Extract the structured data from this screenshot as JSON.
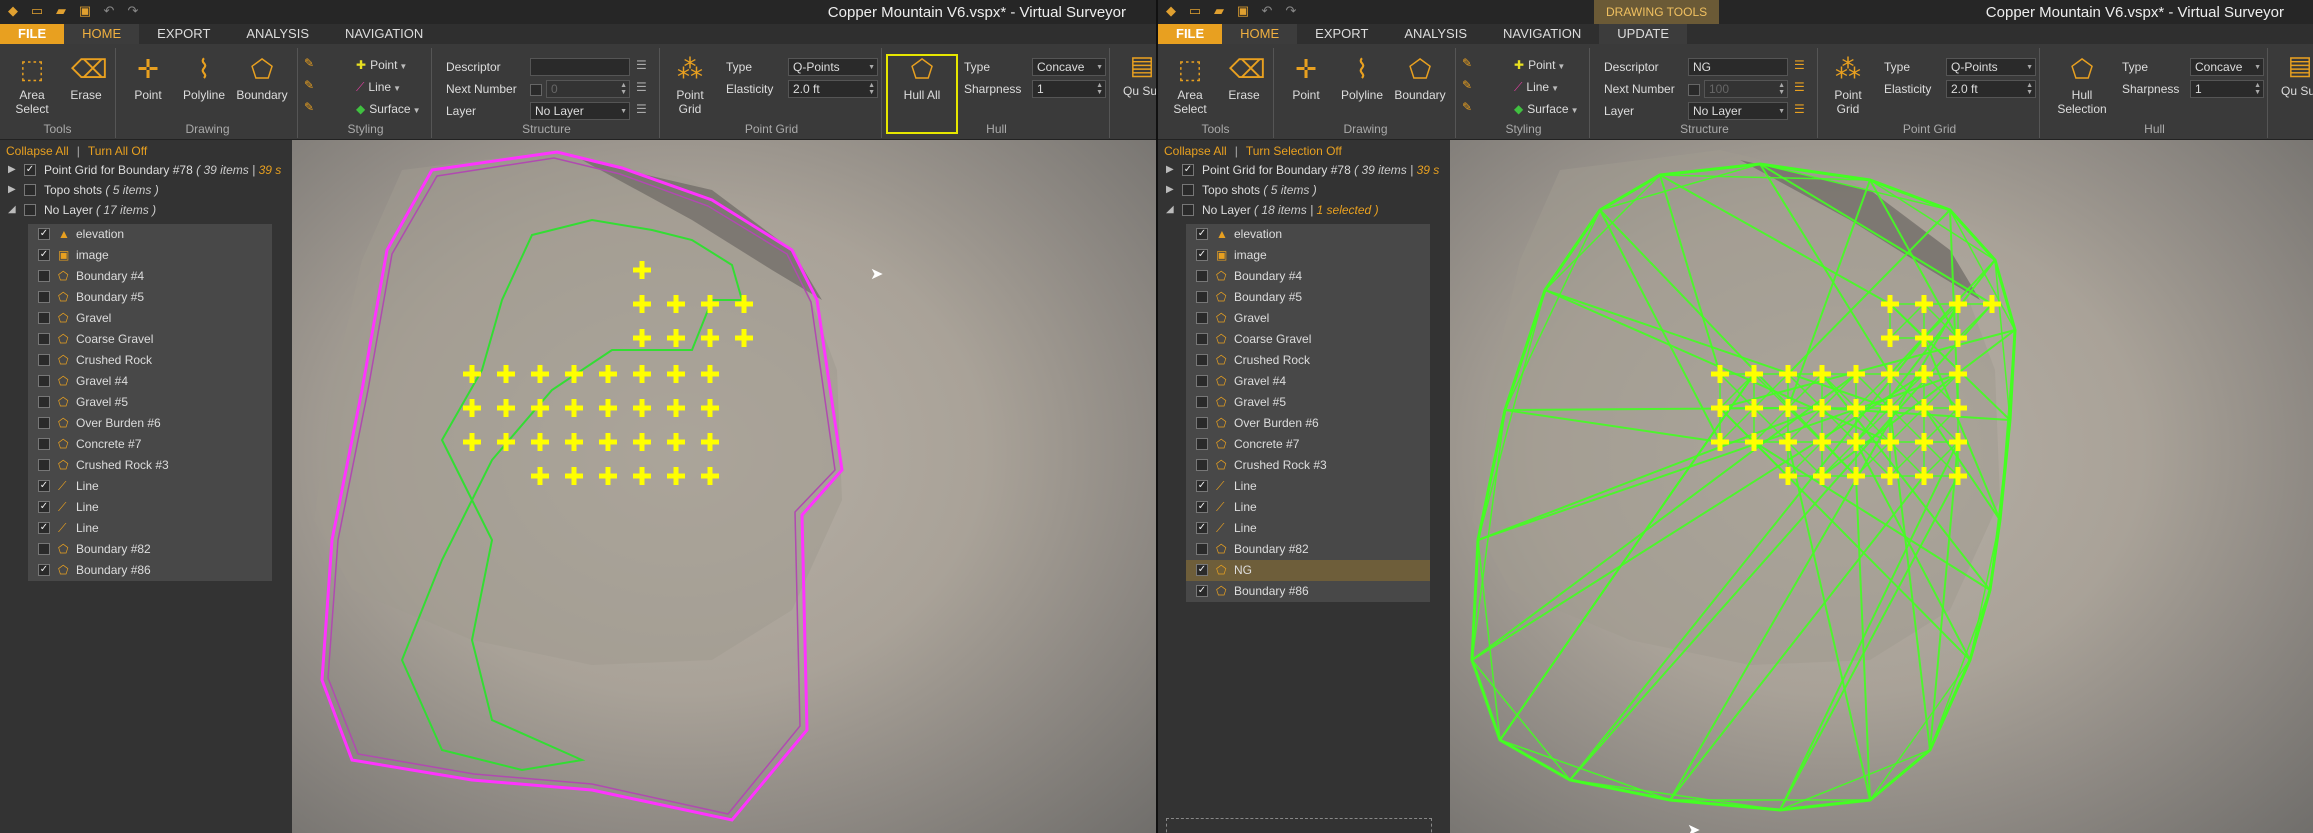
{
  "windows": {
    "left": {
      "title": "Copper Mountain V6.vspx*  -  Virtual Surveyor",
      "tabs": [
        "FILE",
        "HOME",
        "EXPORT",
        "ANALYSIS",
        "NAVIGATION"
      ],
      "active_tab": "HOME",
      "ribbon": {
        "tools": {
          "area_select": "Area Select",
          "erase": "Erase",
          "label": "Tools"
        },
        "drawing": {
          "point": "Point",
          "polyline": "Polyline",
          "boundary": "Boundary",
          "label": "Drawing"
        },
        "styling": {
          "point": "Point",
          "line": "Line",
          "surface": "Surface",
          "label": "Styling"
        },
        "structure": {
          "descriptor_label": "Descriptor",
          "descriptor_value": "",
          "next_number_label": "Next Number",
          "next_number_value": "0",
          "layer_label": "Layer",
          "layer_value": "No Layer",
          "label": "Structure"
        },
        "point_grid": {
          "button": "Point Grid",
          "type_label": "Type",
          "type_value": "Q-Points",
          "elasticity_label": "Elasticity",
          "elasticity_value": "2.0 ft",
          "label": "Point Grid"
        },
        "hull": {
          "button": "Hull All",
          "type_label": "Type",
          "type_value": "Concave",
          "sharpness_label": "Sharpness",
          "sharpness_value": "1",
          "label": "Hull"
        },
        "overflow": "Qu Sur"
      },
      "panel": {
        "collapse_all": "Collapse All",
        "turn_off": "Turn All Off",
        "top_items": [
          {
            "label": "Point Grid for Boundary #78",
            "count": "( 39 items |",
            "extra": "39 s",
            "checked": true
          },
          {
            "label": "Topo shots",
            "count": "( 5 items )",
            "checked": false
          },
          {
            "label": "No Layer",
            "count": "( 17 items )",
            "checked": false
          }
        ],
        "layers": [
          {
            "label": "elevation",
            "checked": true,
            "icon": "elevation-icon",
            "selected": false
          },
          {
            "label": "image",
            "checked": true,
            "icon": "image-icon",
            "selected": false
          },
          {
            "label": "Boundary #4",
            "checked": false,
            "icon": "boundary-icon",
            "selected": false
          },
          {
            "label": "Boundary #5",
            "checked": false,
            "icon": "boundary-icon",
            "selected": false
          },
          {
            "label": "Gravel",
            "checked": false,
            "icon": "boundary-icon",
            "selected": false
          },
          {
            "label": "Coarse Gravel",
            "checked": false,
            "icon": "boundary-icon",
            "selected": false
          },
          {
            "label": "Crushed Rock",
            "checked": false,
            "icon": "boundary-icon",
            "selected": false
          },
          {
            "label": "Gravel #4",
            "checked": false,
            "icon": "boundary-icon",
            "selected": false
          },
          {
            "label": "Gravel #5",
            "checked": false,
            "icon": "boundary-icon",
            "selected": false
          },
          {
            "label": "Over Burden #6",
            "checked": false,
            "icon": "boundary-icon",
            "selected": false
          },
          {
            "label": "Concrete #7",
            "checked": false,
            "icon": "boundary-icon",
            "selected": false
          },
          {
            "label": "Crushed Rock #3",
            "checked": false,
            "icon": "boundary-icon",
            "selected": false
          },
          {
            "label": "Line",
            "checked": true,
            "icon": "line-icon",
            "selected": false
          },
          {
            "label": "Line",
            "checked": true,
            "icon": "line-icon",
            "selected": false
          },
          {
            "label": "Line",
            "checked": true,
            "icon": "line-icon",
            "selected": false
          },
          {
            "label": "Boundary #82",
            "checked": false,
            "icon": "boundary-icon",
            "selected": false
          },
          {
            "label": "Boundary #86",
            "checked": true,
            "icon": "boundary-icon",
            "selected": false
          }
        ]
      }
    },
    "right": {
      "title": "Copper Mountain V6.vspx*  -  Virtual Surveyor",
      "context_tab_group": "DRAWING TOOLS",
      "tabs": [
        "FILE",
        "HOME",
        "EXPORT",
        "ANALYSIS",
        "NAVIGATION",
        "UPDATE"
      ],
      "active_tab": "HOME",
      "ribbon": {
        "tools": {
          "area_select": "Area Select",
          "erase": "Erase",
          "label": "Tools"
        },
        "drawing": {
          "point": "Point",
          "polyline": "Polyline",
          "boundary": "Boundary",
          "label": "Drawing"
        },
        "styling": {
          "point": "Point",
          "line": "Line",
          "surface": "Surface",
          "label": "Styling"
        },
        "structure": {
          "descriptor_label": "Descriptor",
          "descriptor_value": "NG",
          "next_number_label": "Next Number",
          "next_number_value": "100",
          "layer_label": "Layer",
          "layer_value": "No Layer",
          "label": "Structure"
        },
        "point_grid": {
          "button": "Point Grid",
          "type_label": "Type",
          "type_value": "Q-Points",
          "elasticity_label": "Elasticity",
          "elasticity_value": "2.0 ft",
          "label": "Point Grid"
        },
        "hull": {
          "button": "Hull Selection",
          "type_label": "Type",
          "type_value": "Concave",
          "sharpness_label": "Sharpness",
          "sharpness_value": "1",
          "label": "Hull"
        },
        "overflow": "Qu Sur"
      },
      "panel": {
        "collapse_all": "Collapse All",
        "turn_off": "Turn Selection Off",
        "top_items": [
          {
            "label": "Point Grid for Boundary #78",
            "count": "( 39 items |",
            "extra": "39 s",
            "checked": true
          },
          {
            "label": "Topo shots",
            "count": "( 5 items )",
            "checked": false
          },
          {
            "label": "No Layer",
            "count": "( 18 items |",
            "extra": "1 selected )",
            "checked": false
          }
        ],
        "layers": [
          {
            "label": "elevation",
            "checked": true,
            "icon": "elevation-icon",
            "selected": false
          },
          {
            "label": "image",
            "checked": true,
            "icon": "image-icon",
            "selected": false
          },
          {
            "label": "Boundary #4",
            "checked": false,
            "icon": "boundary-icon",
            "selected": false
          },
          {
            "label": "Boundary #5",
            "checked": false,
            "icon": "boundary-icon",
            "selected": false
          },
          {
            "label": "Gravel",
            "checked": false,
            "icon": "boundary-icon",
            "selected": false
          },
          {
            "label": "Coarse Gravel",
            "checked": false,
            "icon": "boundary-icon",
            "selected": false
          },
          {
            "label": "Crushed Rock",
            "checked": false,
            "icon": "boundary-icon",
            "selected": false
          },
          {
            "label": "Gravel #4",
            "checked": false,
            "icon": "boundary-icon",
            "selected": false
          },
          {
            "label": "Gravel #5",
            "checked": false,
            "icon": "boundary-icon",
            "selected": false
          },
          {
            "label": "Over Burden #6",
            "checked": false,
            "icon": "boundary-icon",
            "selected": false
          },
          {
            "label": "Concrete #7",
            "checked": false,
            "icon": "boundary-icon",
            "selected": false
          },
          {
            "label": "Crushed Rock #3",
            "checked": false,
            "icon": "boundary-icon",
            "selected": false
          },
          {
            "label": "Line",
            "checked": true,
            "icon": "line-icon",
            "selected": false
          },
          {
            "label": "Line",
            "checked": true,
            "icon": "line-icon",
            "selected": false
          },
          {
            "label": "Line",
            "checked": true,
            "icon": "line-icon",
            "selected": false
          },
          {
            "label": "Boundary #82",
            "checked": false,
            "icon": "boundary-icon",
            "selected": false
          },
          {
            "label": "NG",
            "checked": true,
            "icon": "boundary-icon",
            "selected": true
          },
          {
            "label": "Boundary #86",
            "checked": true,
            "icon": "boundary-icon",
            "selected": false
          }
        ]
      }
    }
  },
  "colors": {
    "accent": "#e8a020",
    "point_grid": "#ffff00",
    "boundary": "#ff00ff",
    "line": "#33dd33",
    "hull": "#44ff22",
    "hull_selected_box": "#e6e600"
  }
}
